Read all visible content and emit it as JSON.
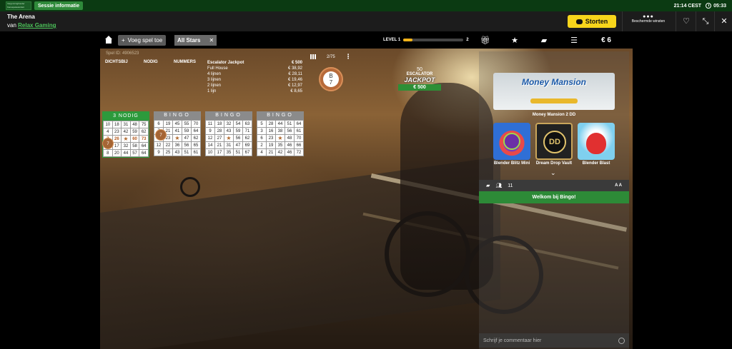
{
  "topbar": {
    "logo_text": "Vergunninghouder Kansspelautoriteit",
    "session_label": "Sessie informatie",
    "time": "21:14 CEST",
    "session_time": "05:33"
  },
  "gamebar": {
    "title": "The Arena",
    "by": "van",
    "provider": "Relax Gaming",
    "deposit_label": "Storten",
    "protected_label": "Beschermde winsten",
    "protected_dots": "●●●"
  },
  "nav": {
    "add_game_label": "Voeg spel toe",
    "add_game_plus": "+",
    "filter_label": "All Stars",
    "filter_close": "✕",
    "level_label": "LEVEL 1",
    "level_next": "2",
    "level_progress": 0.15,
    "balance": "€ 6"
  },
  "game_info": {
    "game_id": "Spel ID: 4906523",
    "columns": [
      "DICHTSBIJ",
      "NODIG",
      "NUMMERS"
    ],
    "counter": "2/75",
    "jackpot_rows": [
      {
        "label": "Escalator Jackpot",
        "value": "€ 500"
      },
      {
        "label": "Full House",
        "value": "€ 38,92"
      },
      {
        "label": "4 lijnen",
        "value": "€ 28,11"
      },
      {
        "label": "3 lijnen",
        "value": "€ 19,46"
      },
      {
        "label": "2 lijnen",
        "value": "€ 12,97"
      },
      {
        "label": "1 lijn",
        "value": "€ 8,65"
      }
    ]
  },
  "ball": {
    "letter": "B",
    "number": "7"
  },
  "escalator": {
    "count": "50",
    "label": "ESCALATOR",
    "title": "JACKPOT",
    "amount": "€ 500"
  },
  "cards": [
    {
      "header": "3 NODIG",
      "called": "7",
      "rows": [
        [
          "10",
          "18",
          "31",
          "48",
          "75"
        ],
        [
          "4",
          "23",
          "42",
          "59",
          "62"
        ],
        [
          "7",
          "26",
          "★",
          "60",
          "73"
        ],
        [
          "11",
          "17",
          "32",
          "58",
          "64"
        ],
        [
          "8",
          "20",
          "44",
          "57",
          "64"
        ]
      ]
    },
    {
      "header": "BINGO",
      "called": "7",
      "rows": [
        [
          "6",
          "19",
          "45",
          "55",
          "70"
        ],
        [
          "7",
          "21",
          "41",
          "59",
          "64"
        ],
        [
          "11",
          "23",
          "★",
          "47",
          "62"
        ],
        [
          "12",
          "22",
          "36",
          "56",
          "65"
        ],
        [
          "9",
          "25",
          "43",
          "51",
          "61"
        ]
      ]
    },
    {
      "header": "BINGO",
      "rows": [
        [
          "11",
          "18",
          "32",
          "54",
          "63"
        ],
        [
          "9",
          "28",
          "43",
          "59",
          "71"
        ],
        [
          "12",
          "27",
          "★",
          "56",
          "62"
        ],
        [
          "14",
          "21",
          "31",
          "47",
          "69"
        ],
        [
          "10",
          "17",
          "35",
          "51",
          "67"
        ]
      ]
    },
    {
      "header": "BINGO",
      "rows": [
        [
          "5",
          "28",
          "44",
          "51",
          "64"
        ],
        [
          "3",
          "16",
          "38",
          "56",
          "61"
        ],
        [
          "6",
          "23",
          "★",
          "48",
          "70"
        ],
        [
          "2",
          "19",
          "35",
          "46",
          "66"
        ],
        [
          "4",
          "21",
          "42",
          "46",
          "72"
        ]
      ]
    }
  ],
  "sidebar": {
    "promo_title": "Money Mansion",
    "promo_name": "Money Mansion 2 DD",
    "games": [
      {
        "name": "Blender Blitz Mini"
      },
      {
        "name": "Dream Drop Vault",
        "logo": "DD"
      },
      {
        "name": "Blender Blast"
      }
    ],
    "chevron": "⌄",
    "chat_users": "11",
    "font_toggle": "A A",
    "welcome": "Welkom bij Bingo!",
    "comment_placeholder": "Schrijf je commentaar hier"
  }
}
